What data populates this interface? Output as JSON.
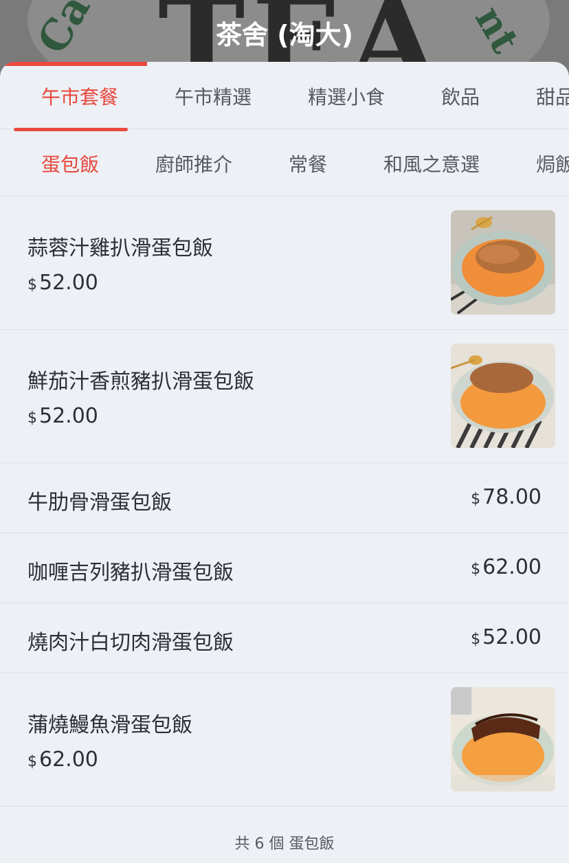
{
  "header": {
    "title": "茶舍 (淘大)"
  },
  "tabs": [
    "午市套餐",
    "午市精選",
    "精選小食",
    "飲品",
    "甜品"
  ],
  "subtabs": [
    "蛋包飯",
    "廚師推介",
    "常餐",
    "和風之意選",
    "焗飯"
  ],
  "items": [
    {
      "name": "蒜蓉汁雞扒滑蛋包飯",
      "currency": "$",
      "price": "52.00",
      "has_image": true
    },
    {
      "name": "鮮茄汁香煎豬扒滑蛋包飯",
      "currency": "$",
      "price": "52.00",
      "has_image": true
    },
    {
      "name": "牛肋骨滑蛋包飯",
      "currency": "$",
      "price": "78.00",
      "has_image": false
    },
    {
      "name": "咖喱吉列豬扒滑蛋包飯",
      "currency": "$",
      "price": "62.00",
      "has_image": false
    },
    {
      "name": "燒肉汁白切肉滑蛋包飯",
      "currency": "$",
      "price": "52.00",
      "has_image": false
    },
    {
      "name": "蒲燒鰻魚滑蛋包飯",
      "currency": "$",
      "price": "62.00",
      "has_image": true
    }
  ],
  "footer": {
    "count_text": "共 6 個 蛋包飯"
  },
  "colors": {
    "accent": "#ea4a3f",
    "text": "#2c2f35",
    "background": "#edf0f5"
  }
}
